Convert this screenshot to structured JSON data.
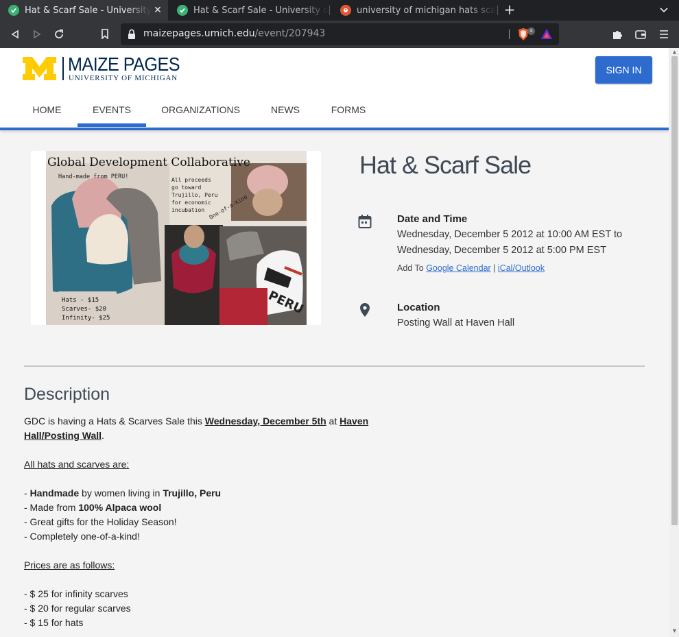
{
  "browser": {
    "tabs": [
      {
        "title": "Hat & Scarf Sale - University of Michigan",
        "active": true
      },
      {
        "title": "Hat & Scarf Sale - University of Michigan",
        "active": false
      },
      {
        "title": "university of michigan hats scarves",
        "active": false
      }
    ],
    "url_host": "maizepages.umich.edu",
    "url_path": "/event/207943",
    "shield_count": "4"
  },
  "site": {
    "logo_title": "MAIZE PAGES",
    "logo_subtitle": "UNIVERSITY OF MICHIGAN",
    "signin_label": "SIGN IN",
    "nav": [
      "HOME",
      "EVENTS",
      "ORGANIZATIONS",
      "NEWS",
      "FORMS"
    ],
    "active_nav": "EVENTS"
  },
  "poster": {
    "title": "Global Development Collaborative",
    "subtitle": "Hand-made from PERU!",
    "note": "All proceeds go toward Trujillo, Peru for economic incubation",
    "tag": "One-of-a-Kind",
    "prices": [
      "Hats - $15",
      "Scarves- $20",
      "Infinity- $25"
    ],
    "hat_text": "PERU"
  },
  "event": {
    "title": "Hat & Scarf Sale",
    "date_label": "Date and Time",
    "date_start": "Wednesday, December 5 2012 at 10:00 AM EST to",
    "date_end": "Wednesday, December 5 2012 at 5:00 PM EST",
    "add_to": "Add To",
    "google_calendar": "Google Calendar",
    "separator": "|",
    "ical": "iCal/Outlook",
    "location_label": "Location",
    "location": "Posting Wall at Haven Hall"
  },
  "description": {
    "heading": "Description",
    "intro_a": "GDC is having a Hats & Scarves Sale this ",
    "intro_date": "Wednesday, December 5th",
    "intro_b": " at ",
    "intro_place_1": "Haven",
    "intro_place_2": "Hall/Posting Wall",
    "intro_end": ".",
    "all_hats_heading": "All hats and scarves are:",
    "b1_a": "- ",
    "b1_b": "Handmade",
    "b1_c": " by women living in ",
    "b1_d": "Trujillo, Peru",
    "b2_a": "- Made from ",
    "b2_b": "100% Alpaca wool",
    "b3": "- Great gifts for the Holiday Season!",
    "b4": "- Completely one-of-a-kind!",
    "prices_heading": "Prices are as follows:",
    "p1": "- $ 25 for infinity scarves",
    "p2": "- $ 20 for regular scarves",
    "p3": "- $ 15 for hats"
  }
}
